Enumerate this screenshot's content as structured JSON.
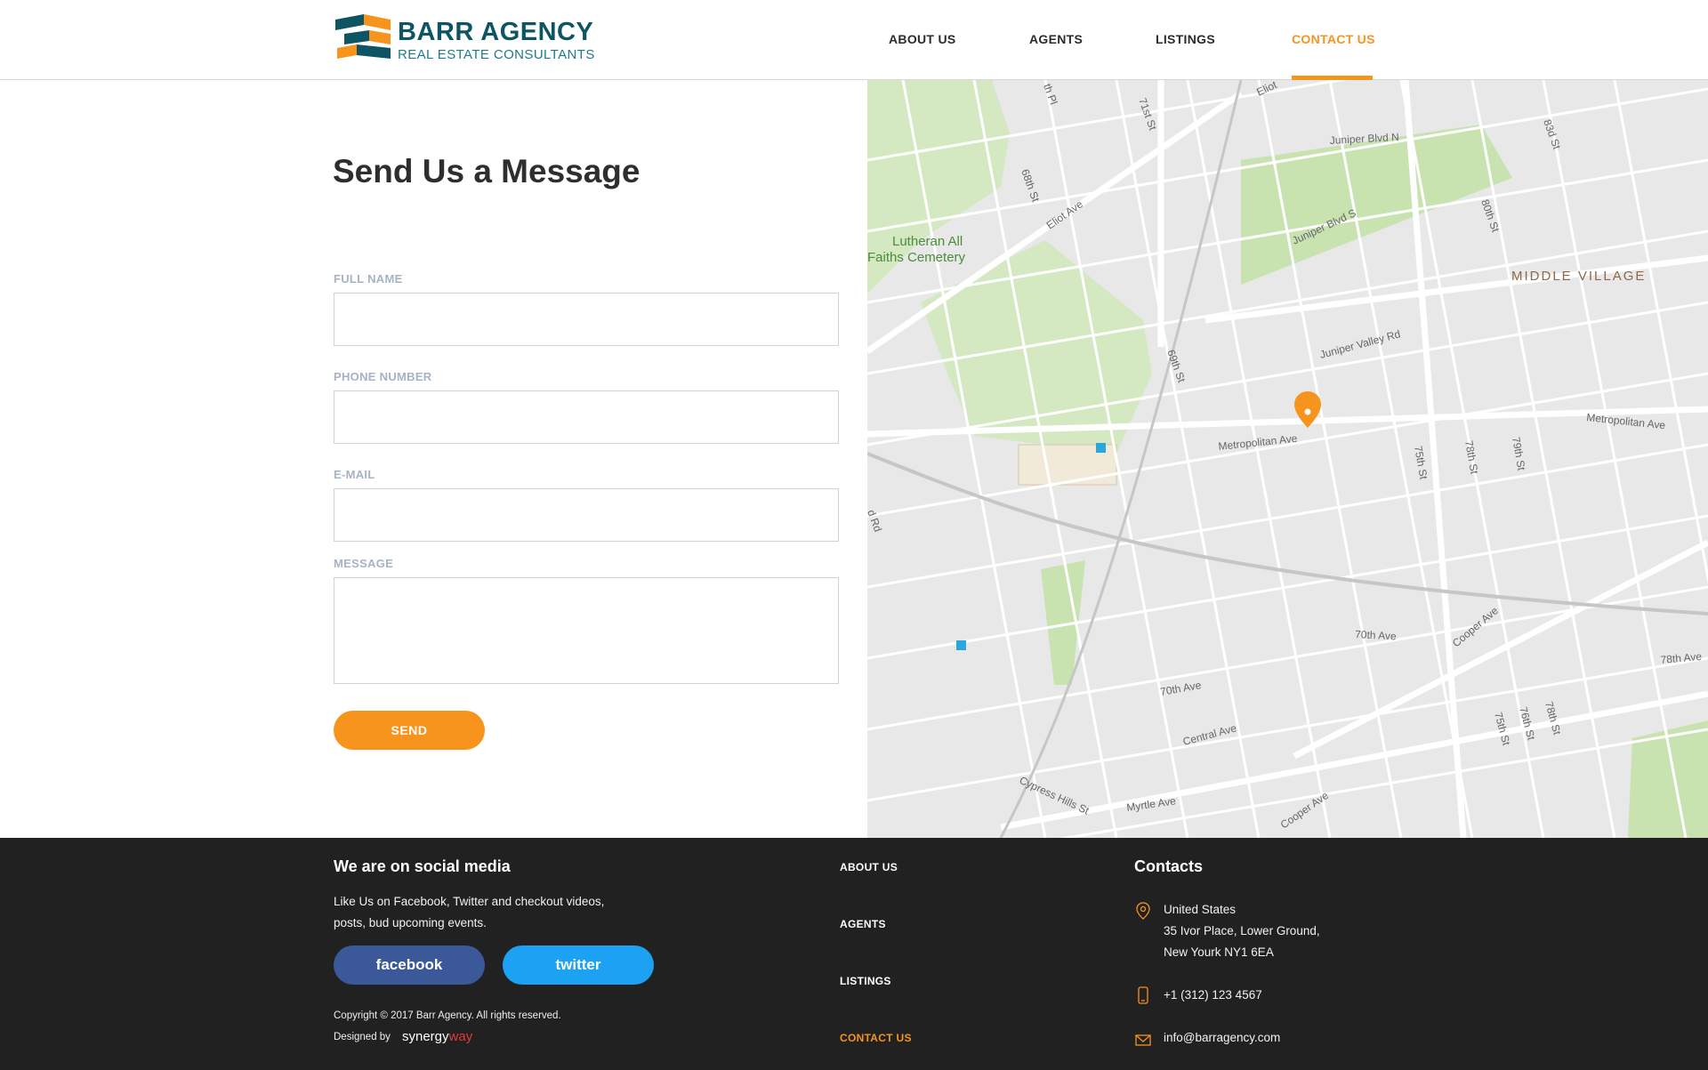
{
  "brand": {
    "name": "BARR AGENCY",
    "tagline": "REAL ESTATE CONSULTANTS",
    "colors": {
      "accent": "#f6941e",
      "teal": "#0e5563",
      "footer_bg": "#212121"
    }
  },
  "nav": {
    "items": [
      {
        "label": "ABOUT US",
        "active": false
      },
      {
        "label": "AGENTS",
        "active": false
      },
      {
        "label": "LISTINGS",
        "active": false
      },
      {
        "label": "CONTACT US",
        "active": true
      }
    ]
  },
  "form": {
    "title": "Send Us a Message",
    "fields": {
      "full_name": {
        "label": "FULL NAME",
        "value": ""
      },
      "phone": {
        "label": "PHONE NUMBER",
        "value": ""
      },
      "email": {
        "label": "E-MAIL",
        "value": ""
      },
      "message": {
        "label": "MESSAGE",
        "value": ""
      }
    },
    "send_label": "SEND"
  },
  "map": {
    "area_label": "MIDDLE VILLAGE",
    "place_label_1": "Lutheran All",
    "place_label_2": "Faiths Cemetery",
    "streets": {
      "metropolitan_1": "Metropolitan Ave",
      "metropolitan_2": "Metropolitan Ave",
      "juniper_n": "Juniper Blvd N",
      "juniper_s": "Juniper Blvd S",
      "juniper_valley": "Juniper Valley Rd",
      "eliot": "Eliot Ave",
      "eliot_top": "Eliot",
      "st_69": "69th St",
      "st_68": "68th St",
      "st_71": "71st St",
      "st_80": "80th St",
      "st_83": "83d St",
      "st_75a": "75th St",
      "st_78a": "78th St",
      "st_79": "79th St",
      "ave_70a": "70th Ave",
      "ave_70b": "70th Ave",
      "cooper_1": "Cooper Ave",
      "cooper_2": "Cooper Ave",
      "central": "Central Ave",
      "cypress": "Cypress Hills St",
      "myrtle": "Myrtle Ave",
      "st_75b": "75th St",
      "st_76": "76th St",
      "st_78b": "78th St",
      "ave_78": "78th Ave",
      "rd_left": "d Rd",
      "pl_top": "th Pl"
    },
    "marker_icon": "location-pin-icon",
    "transit_icon": "metro-icon"
  },
  "footer": {
    "social": {
      "heading": "We are on social media",
      "text_line1": "Like Us on Facebook, Twitter and checkout videos,",
      "text_line2": "posts, bud upcoming events.",
      "facebook": "facebook",
      "twitter": "twitter"
    },
    "links": [
      {
        "label": "ABOUT US",
        "active": false
      },
      {
        "label": "AGENTS",
        "active": false
      },
      {
        "label": "LISTINGS",
        "active": false
      },
      {
        "label": "CONTACT US",
        "active": true
      }
    ],
    "copyright": "Copyright © 2017 Barr Agency. All rights reserved.",
    "designed_by": "Designed by",
    "designer_part1": "synergy",
    "designer_part2": "way",
    "contacts": {
      "heading": "Contacts",
      "address_line1": "United States",
      "address_line2": "35 Ivor Place, Lower Ground,",
      "address_line3": "New Yourk NY1 6EA",
      "phone": "+1 (312) 123 4567",
      "email": "info@barragency.com"
    }
  }
}
